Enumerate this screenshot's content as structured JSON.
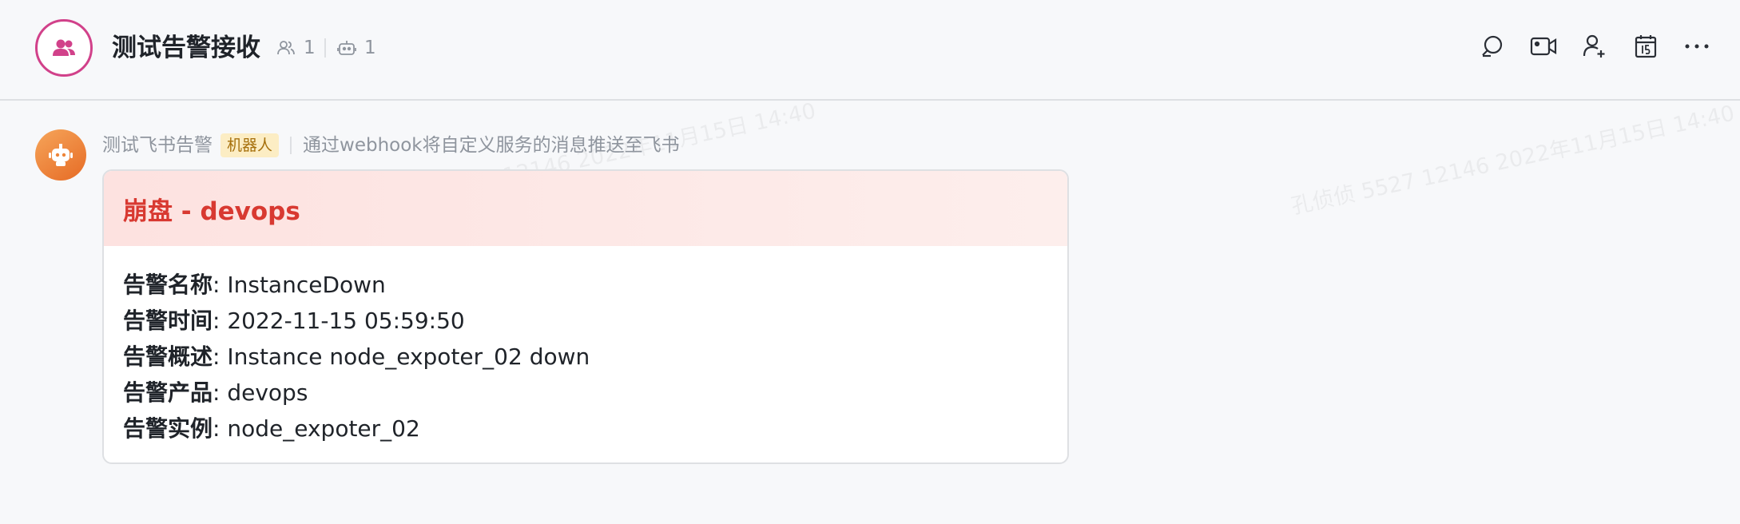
{
  "header": {
    "title": "测试告警接收",
    "member_count": "1",
    "bot_count": "1"
  },
  "message": {
    "sender_name": "测试飞书告警",
    "badge": "机器人",
    "description": "通过webhook将自定义服务的消息推送至飞书"
  },
  "card": {
    "title": "崩盘 - devops",
    "rows": [
      {
        "label": "告警名称",
        "value": "InstanceDown"
      },
      {
        "label": "告警时间",
        "value": "2022-11-15 05:59:50"
      },
      {
        "label": "告警概述",
        "value": "Instance node_expoter_02 down"
      },
      {
        "label": "告警产品",
        "value": "devops"
      },
      {
        "label": "告警实例",
        "value": "node_expoter_02"
      }
    ]
  },
  "watermark": "孔侦侦 5527 12146 2022年11月15日 14:40",
  "colors": {
    "group_avatar_border": "#d1418a",
    "card_title": "#d83931",
    "bot_avatar": "#ee8539",
    "badge_bg": "#fcedc4"
  },
  "icons": [
    "group-icon",
    "members-icon",
    "bot-icon",
    "search-chat-icon",
    "video-icon",
    "add-member-icon",
    "calendar-icon",
    "more-icon",
    "robot-avatar-icon"
  ]
}
